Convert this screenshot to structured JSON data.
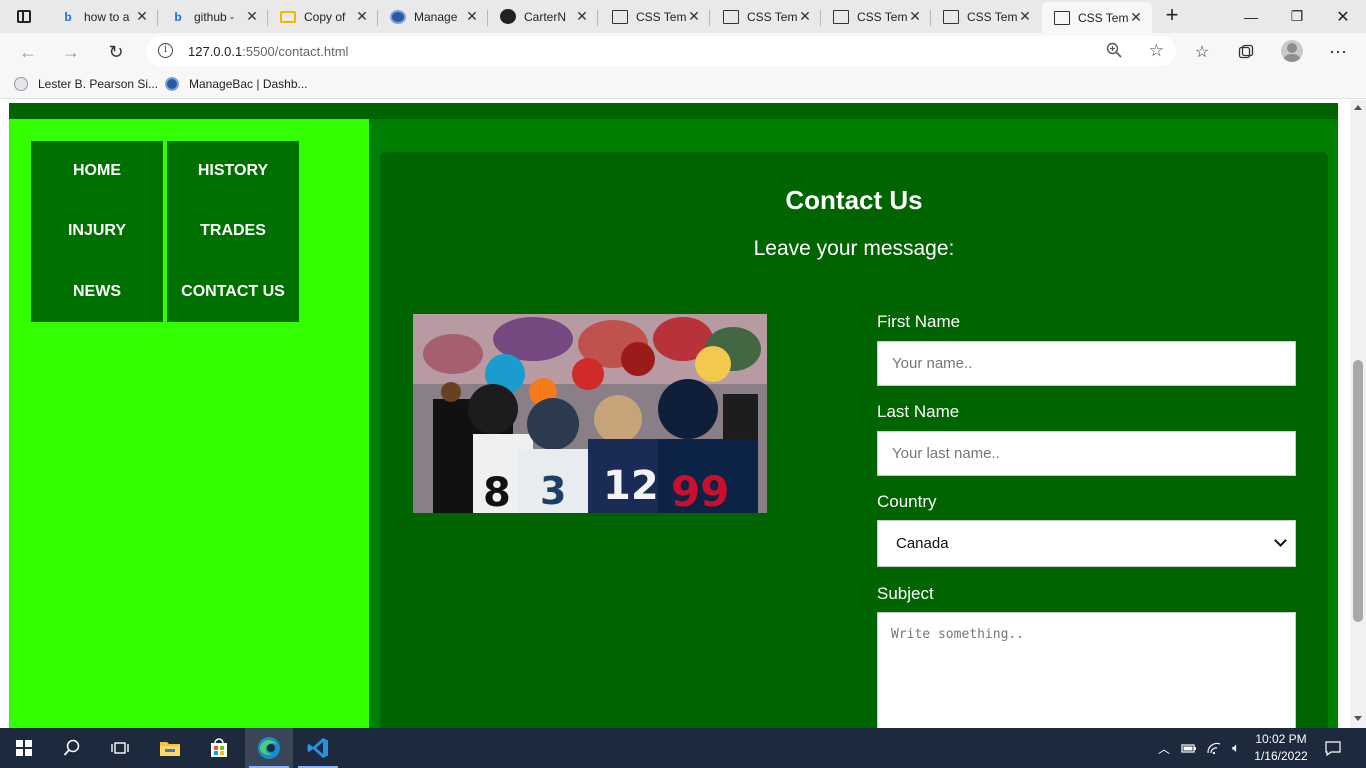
{
  "browser": {
    "tabs": [
      {
        "title": "how to a",
        "icon": "bing-icon"
      },
      {
        "title": "github -",
        "icon": "bing-icon"
      },
      {
        "title": "Copy of",
        "icon": "slides-icon"
      },
      {
        "title": "Manage",
        "icon": "managebac-icon"
      },
      {
        "title": "CarterN",
        "icon": "github-icon"
      },
      {
        "title": "CSS Tem",
        "icon": "page-icon"
      },
      {
        "title": "CSS Tem",
        "icon": "page-icon"
      },
      {
        "title": "CSS Tem",
        "icon": "page-icon"
      },
      {
        "title": "CSS Tem",
        "icon": "page-icon"
      },
      {
        "title": "CSS Tem",
        "icon": "page-icon",
        "active": true
      }
    ],
    "address": {
      "host": "127.0.0.1",
      "rest": ":5500/contact.html"
    },
    "favorites": [
      {
        "label": "Lester B. Pearson Si...",
        "icon": "school-icon"
      },
      {
        "label": "ManageBac | Dashb...",
        "icon": "managebac-icon"
      }
    ]
  },
  "page": {
    "nav": {
      "home": "HOME",
      "history": "HISTORY",
      "injury": "INJURY",
      "trades": "TRADES",
      "news": "NEWS",
      "contact": "CONTACT US"
    },
    "title": "Contact Us",
    "subtitle": "Leave your message:",
    "form": {
      "first_name_label": "First Name",
      "first_name_placeholder": "Your name..",
      "last_name_label": "Last Name",
      "last_name_placeholder": "Your last name..",
      "country_label": "Country",
      "country_value": "Canada",
      "subject_label": "Subject",
      "subject_placeholder": "Write something.."
    }
  },
  "taskbar": {
    "time": "10:02 PM",
    "date": "1/16/2022"
  },
  "colors": {
    "sidebar": "#33ff00",
    "menu": "#007000",
    "main": "#008000",
    "card": "#006400",
    "taskbar": "#1d2a3e"
  }
}
